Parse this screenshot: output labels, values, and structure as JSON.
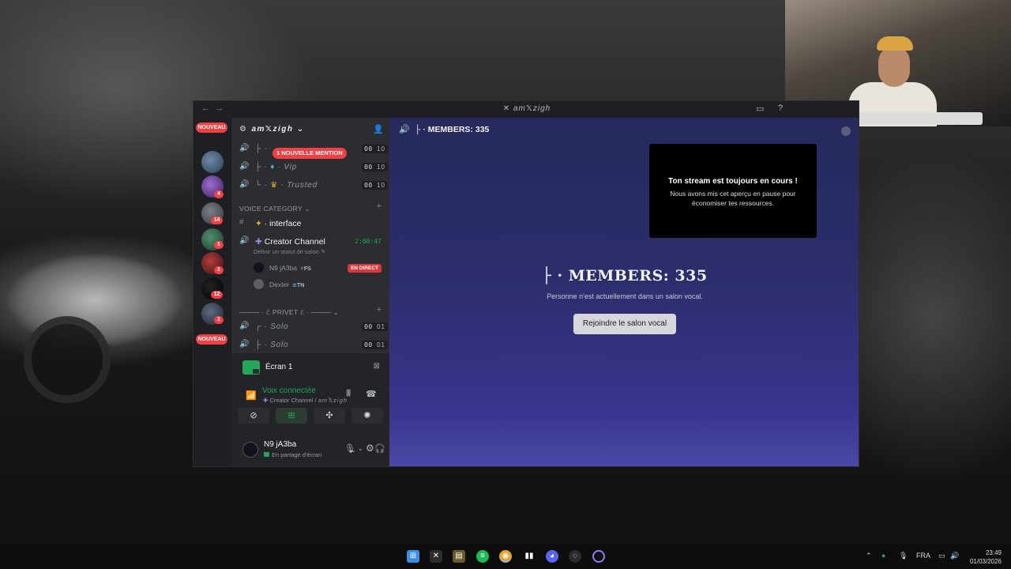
{
  "window": {
    "title": "am𝕏zigh",
    "nav_back": "←",
    "nav_forward": "→",
    "title_icon": "x-logo-icon"
  },
  "server_rail": {
    "new_badge_top": "NOUVEAU",
    "new_badge_bottom": "NOUVEAU",
    "badges": [
      "4",
      "14",
      "1",
      "1",
      "12",
      "1"
    ]
  },
  "sidebar": {
    "server_name": "am𝕏zigh",
    "mention_pill": "1 NOUVELLE MENTION",
    "top_channels": [
      {
        "prefix": "├ ·",
        "name": "",
        "count_a": "00",
        "count_b": "10"
      },
      {
        "prefix": "├ ·",
        "name": "Vip",
        "count_a": "00",
        "count_b": "10"
      },
      {
        "prefix": "└ ·",
        "name": "Trusted",
        "count_a": "00",
        "count_b": "10"
      }
    ],
    "voice_category": "VOICE CATEGORY",
    "text_channel": "· interface",
    "active_channel": {
      "name": "Creator Channel",
      "timer": "2:00:47",
      "status": "Définir un statut de salon"
    },
    "voice_users": [
      {
        "name": "N9 jA3ba",
        "tag": "FS",
        "live": "EN DIRECT"
      },
      {
        "name": "Dexter",
        "tag": "TN"
      }
    ],
    "private_category": "──── · ℰ PRIVET ℰ · ────",
    "private_channels": [
      {
        "prefix": "┌ ·",
        "name": "Solo",
        "count_a": "00",
        "count_b": "01"
      },
      {
        "prefix": "├ ·",
        "name": "Solo",
        "count_a": "00",
        "count_b": "01"
      }
    ]
  },
  "share_panel": {
    "screen_label": "Écran 1",
    "voice_connected": "Voix connectée",
    "voice_location_channel": "Creator Channel /",
    "voice_location_server": "am𝕏zigh",
    "user_name": "N9 jA3ba",
    "user_status": "En partage d'écran"
  },
  "stage": {
    "header_title": "├ · MEMBERS: 335",
    "preview_heading": "Ton stream est toujours en cours !",
    "preview_text": "Nous avons mis cet aperçu en pause pour économiser tes ressources.",
    "big_title": "├ · MEMBERS: 335",
    "empty_message": "Personne n'est actuellement dans un salon vocal.",
    "join_button": "Rejoindre le salon vocal"
  },
  "taskbar": {
    "language": "FRA",
    "time": "23:49",
    "date": "01/03/2026",
    "apps": [
      "windows-start-icon",
      "xbox-icon",
      "file-explorer-icon",
      "spotify-icon",
      "chrome-icon",
      "audio-app-icon",
      "discord-icon",
      "game-launcher-icon",
      "circle-app-icon"
    ]
  },
  "colors": {
    "accent_green": "#23a55a",
    "danger_red": "#f23f43",
    "stage_purple": "#3a3590"
  }
}
